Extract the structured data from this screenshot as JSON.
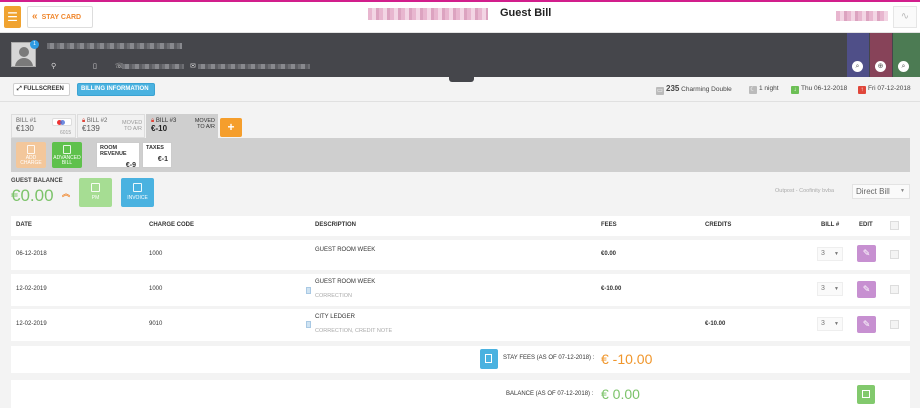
{
  "header": {
    "menu_icon": "hamburger-icon",
    "stay_card_label": "STAY CARD",
    "title": "Guest Bill"
  },
  "guest": {
    "badge_count": "1"
  },
  "toolbar": {
    "fullscreen_label": "FULLSCREEN",
    "billing_info_label": "BILLING INFORMATION",
    "room_number": "235",
    "room_type": "Charming Double",
    "nights": "1 night",
    "arrival": "Thu 06-12-2018",
    "departure": "Fri 07-12-2018"
  },
  "bills": [
    {
      "label": "BILL #1",
      "amount": "€130",
      "card": "6015"
    },
    {
      "label": "BILL #2",
      "amount": "€139",
      "moved": "MOVED TO A/R"
    },
    {
      "label": "BILL #3",
      "amount": "€-10",
      "moved": "MOVED TO A/R"
    }
  ],
  "bill_actions": {
    "add_charge": "ADD CHARGE",
    "advanced_bill": "ADVANCED BILL"
  },
  "summary": {
    "room_revenue_label": "ROOM REVENUE",
    "room_revenue_value": "€-9",
    "taxes_label": "TAXES",
    "taxes_value": "€-1"
  },
  "balance": {
    "label": "GUEST BALANCE",
    "value": "€0.00",
    "pm_label": "PM",
    "invoice_label": "INVOICE",
    "outpost_text": "Outpost - Coofinity bvba",
    "direct_bill": "Direct Bill"
  },
  "table": {
    "headers": {
      "date": "DATE",
      "code": "CHARGE CODE",
      "desc": "DESCRIPTION",
      "fees": "FEES",
      "credits": "CREDITS",
      "bill": "BILL #",
      "edit": "EDIT"
    },
    "rows": [
      {
        "date": "06-12-2018",
        "code": "1000",
        "desc": "GUEST ROOM WEEK",
        "sub": "",
        "fees": "€0.00",
        "credits": "",
        "bill": "3"
      },
      {
        "date": "12-02-2019",
        "code": "1000",
        "desc": "GUEST ROOM WEEK",
        "sub": "CORRECTION",
        "fees": "€-10.00",
        "credits": "",
        "bill": "3"
      },
      {
        "date": "12-02-2019",
        "code": "9010",
        "desc": "CITY LEDGER",
        "sub": "CORRECTION, CREDIT NOTE",
        "fees": "",
        "credits": "€-10.00",
        "bill": "3"
      }
    ]
  },
  "totals": {
    "stay_fees_label": "STAY FEES (AS OF 07-12-2018) :",
    "stay_fees_value": "€ -10.00",
    "balance_label": "BALANCE (AS OF 07-12-2018) :",
    "balance_value": "€ 0.00"
  },
  "colors": {
    "accent_orange": "#f0a330",
    "accent_blue": "#4ab2e0",
    "accent_green": "#7cc36a",
    "accent_purple": "#c790d1",
    "brand_magenta": "#d21e8c"
  }
}
